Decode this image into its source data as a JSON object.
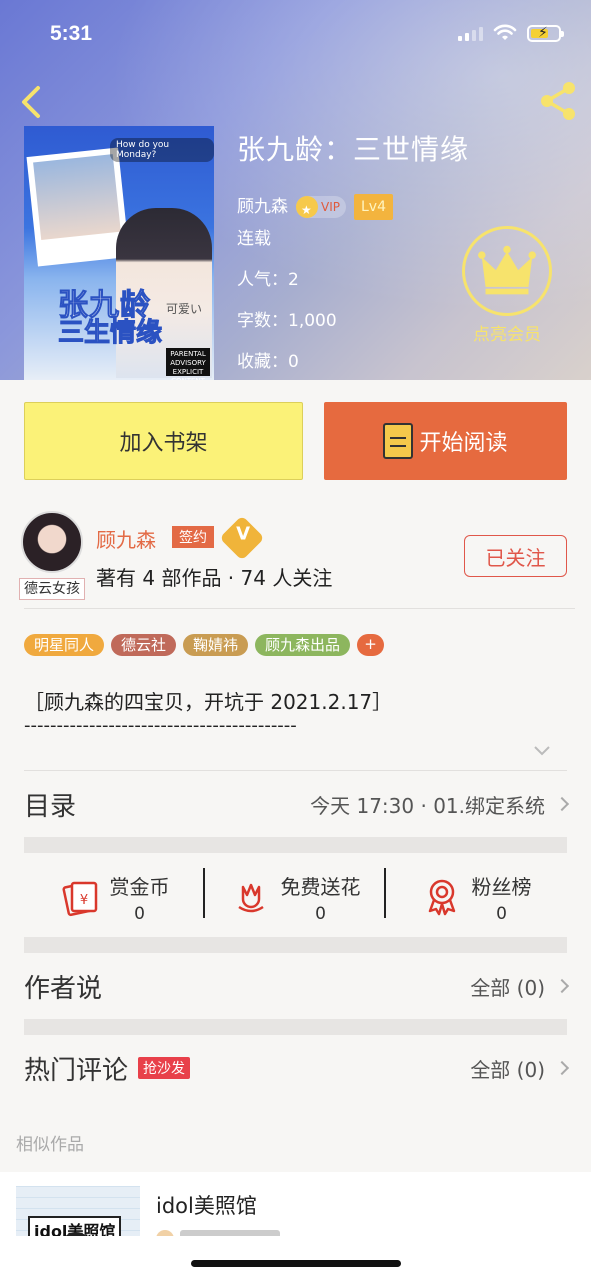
{
  "status_bar": {
    "time": "5:31"
  },
  "book": {
    "title": "张九龄：三世情缘",
    "author": "顾九森",
    "vip_label": "VIP",
    "level": "Lv4",
    "status": "连载",
    "popularity": "人气：2",
    "word_count": "字数：1,000",
    "favorites": "收藏：0",
    "cover": {
      "header_text": "How do you Monday?",
      "title_line1": "张九龄",
      "title_line2": "三生情缘",
      "side_text": "可爱い",
      "advisory": "PARENTAL ADVISORY EXPLICIT CONTENT"
    }
  },
  "member": {
    "label": "点亮会员"
  },
  "actions": {
    "add_shelf": "加入书架",
    "start_read": "开始阅读"
  },
  "author_block": {
    "avatar_tag": "德云女孩",
    "name": "顾九森",
    "sign_badge": "签约",
    "verified_icon": "V",
    "stats": "著有 4 部作品 · 74 人关注",
    "follow_label": "已关注"
  },
  "tags": [
    {
      "label": "明星同人",
      "color": "#f0a93e"
    },
    {
      "label": "德云社",
      "color": "#c06a5a"
    },
    {
      "label": "鞠婧祎",
      "color": "#c99c52"
    },
    {
      "label": "顾九森出品",
      "color": "#8db65e"
    },
    {
      "label": "+",
      "color": "#e66a3f"
    }
  ],
  "intro": {
    "text": "［顾九森的四宝贝，开坑于 2021.2.17］",
    "dashes": "------------------------------------------"
  },
  "catalog": {
    "label": "目录",
    "latest": "今天 17:30 · 01.绑定系统"
  },
  "gifts": [
    {
      "name": "赏金币",
      "value": "0",
      "icon": "red-envelope-icon"
    },
    {
      "name": "免费送花",
      "value": "0",
      "icon": "flower-icon"
    },
    {
      "name": "粉丝榜",
      "value": "0",
      "icon": "medal-icon"
    }
  ],
  "author_says": {
    "label": "作者说",
    "right": "全部 (0)"
  },
  "hot_comments": {
    "label": "热门评论",
    "badge": "抢沙发",
    "right": "全部 (0)"
  },
  "similar": {
    "heading": "相似作品",
    "item_title": "idol美照馆",
    "thumb_label": "idol美照馆"
  },
  "colors": {
    "accent": "#e66a3f",
    "shelf": "#fbf278",
    "crown": "#f7e36c",
    "follow": "#e0574a"
  }
}
